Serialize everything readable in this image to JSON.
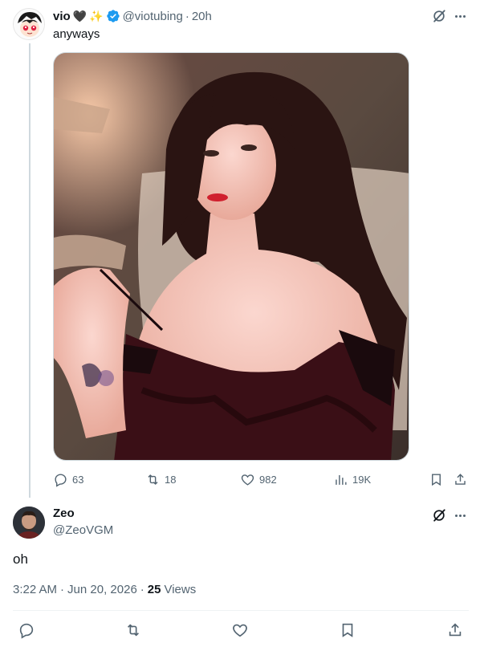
{
  "parent_tweet": {
    "display_name": "vio",
    "handle": "@viotubing",
    "separator": "·",
    "timestamp": "20h",
    "text": "anyways",
    "emoji_heart": "🖤",
    "emoji_sparkle": "✨",
    "stats": {
      "replies": "63",
      "reposts": "18",
      "likes": "982",
      "views": "19K"
    }
  },
  "reply_tweet": {
    "display_name": "Zeo",
    "handle": "@ZeoVGM",
    "text": "oh",
    "time": "3:22 AM",
    "dot": "·",
    "date": "Jun 20, 2026",
    "dot2": "·",
    "views_count": "25",
    "views_label": "Views"
  },
  "colors": {
    "verified": "#1d9bf0",
    "muted": "#536471",
    "text": "#0f1419"
  },
  "icons": [
    "reply-icon",
    "repost-icon",
    "like-icon",
    "views-icon",
    "bookmark-icon",
    "share-icon",
    "grok-icon",
    "more-icon",
    "verified-badge-icon"
  ]
}
